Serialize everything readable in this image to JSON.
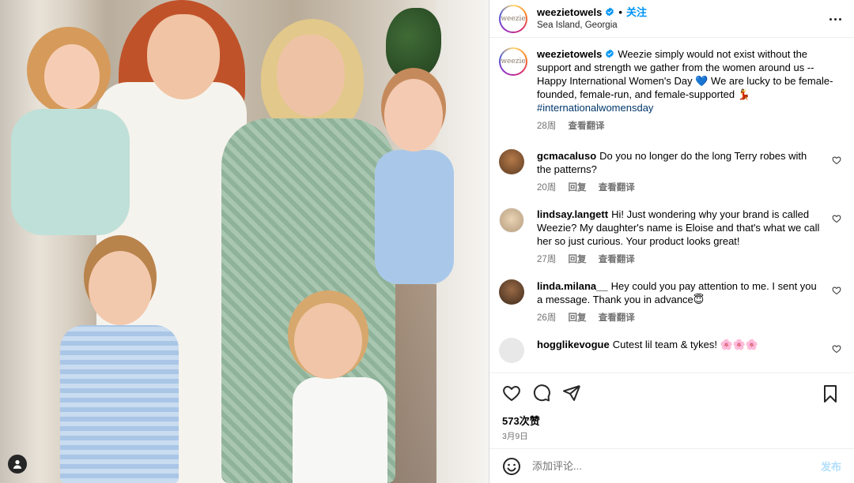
{
  "header": {
    "username": "weezietowels",
    "avatar_text": "weezie",
    "dot": "•",
    "follow_label": "关注",
    "location": "Sea Island, Georgia"
  },
  "caption": {
    "username": "weezietowels",
    "text_1": "Weezie simply would not exist without the support and strength we gather from the women around us -- Happy International Women's Day ",
    "emoji_heart": "💙",
    "text_2": " We are lucky to be female-founded, female-run, and female-supported ",
    "emoji_figure": "💃",
    "hashtag": "#internationalwomensday",
    "age": "28周",
    "translate": "查看翻译"
  },
  "comments": [
    {
      "username": "gcmacaluso",
      "text": "Do you no longer do the long Terry robes with the patterns?",
      "age": "20周",
      "reply": "回复",
      "translate": "查看翻译"
    },
    {
      "username": "lindsay.langett",
      "text": "Hi! Just wondering why your brand is called Weezie? My daughter's name is Eloise and that's what we call her so just curious. Your product looks great!",
      "age": "27周",
      "reply": "回复",
      "translate": "查看翻译"
    },
    {
      "username": "linda.milana__",
      "text": "Hey could you pay attention to me. I sent you a message. Thank you in advance😇",
      "age": "26周",
      "reply": "回复",
      "translate": "查看翻译"
    },
    {
      "username": "hogglikevogue",
      "text": "Cutest lil team & tykes! 🌸🌸🌸"
    }
  ],
  "engagement": {
    "likes": "573次赞",
    "date": "3月9日"
  },
  "composer": {
    "placeholder": "添加评论...",
    "post_label": "发布"
  },
  "icons": {
    "heart": "heart-icon",
    "comment": "comment-icon",
    "share": "share-icon",
    "bookmark": "bookmark-icon",
    "emoji": "emoji-icon",
    "more": "more-icon",
    "verified": "verified-badge-icon",
    "user_tag": "user-tag-icon"
  },
  "colors": {
    "accent": "#0095f6",
    "hashtag": "#00376b",
    "muted": "#737373",
    "post_disabled": "#b2dffc"
  }
}
